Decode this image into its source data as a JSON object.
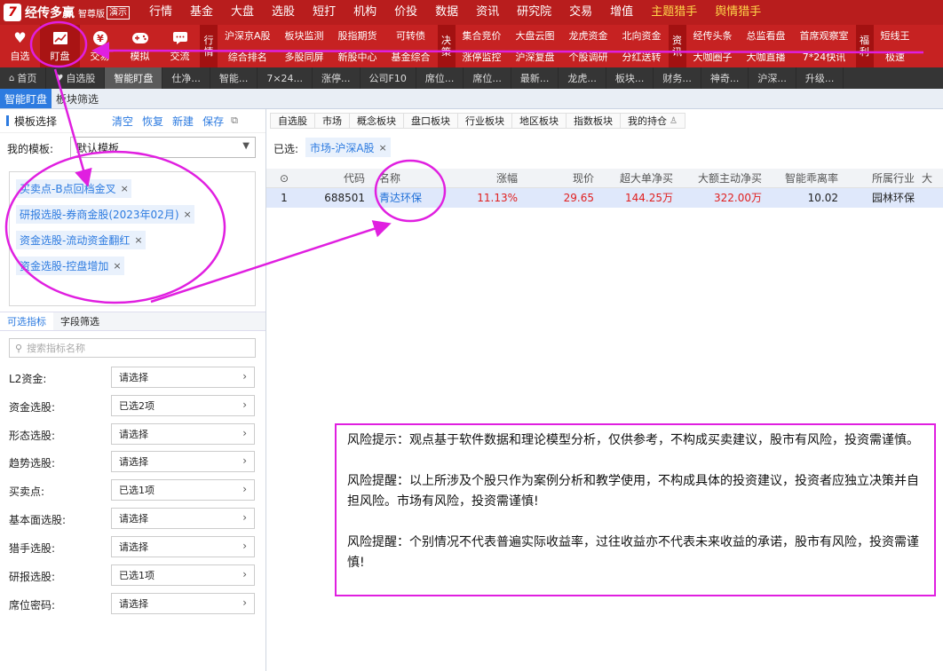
{
  "menubar": {
    "logo_mark": "7",
    "app_name": "经传多赢",
    "edition": "智尊版",
    "demo_badge": "演示",
    "items": [
      "行情",
      "基金",
      "大盘",
      "选股",
      "短打",
      "机构",
      "价投",
      "数据",
      "资讯",
      "研究院",
      "交易",
      "增值",
      "主题猎手",
      "舆情猎手"
    ]
  },
  "toolbar": {
    "buttons": [
      {
        "label": "自选",
        "icon": "heart-icon"
      },
      {
        "label": "盯盘",
        "icon": "chart-monitor-icon"
      },
      {
        "label": "交易",
        "icon": "yen-icon"
      },
      {
        "label": "模拟",
        "icon": "gamepad-icon"
      },
      {
        "label": "交流",
        "icon": "chat-icon"
      }
    ],
    "groups": [
      {
        "vlabel": [
          "行",
          "情"
        ],
        "links": [
          "沪深京A股",
          "综合排名",
          "板块监测",
          "多股同屏",
          "股指期货",
          "新股中心",
          "可转债",
          "基金综合"
        ]
      },
      {
        "vlabel": [
          "决",
          "策"
        ],
        "links": [
          "集合竞价",
          "涨停监控",
          "大盘云图",
          "沪深复盘",
          "龙虎资金",
          "个股调研",
          "北向资金",
          "分红送转"
        ]
      },
      {
        "vlabel": [
          "资",
          "讯"
        ],
        "links": [
          "经传头条",
          "大咖圈子",
          "总监看盘",
          "大咖直播",
          "首席观察室",
          "7*24快讯"
        ]
      },
      {
        "vlabel": [
          "福",
          "利"
        ],
        "links": [
          "短线王",
          "极速"
        ]
      }
    ]
  },
  "tabbar": {
    "items": [
      {
        "label": "首页",
        "icon": "home-icon"
      },
      {
        "label": "自选股",
        "icon": "heart-icon"
      },
      {
        "label": "智能盯盘",
        "icon": ""
      },
      {
        "label": "仕净...",
        "icon": ""
      },
      {
        "label": "智能...",
        "icon": ""
      },
      {
        "label": "7×24...",
        "icon": ""
      },
      {
        "label": "涨停...",
        "icon": ""
      },
      {
        "label": "公司F10",
        "icon": ""
      },
      {
        "label": "席位...",
        "icon": ""
      },
      {
        "label": "席位...",
        "icon": ""
      },
      {
        "label": "最新...",
        "icon": ""
      },
      {
        "label": "龙虎...",
        "icon": ""
      },
      {
        "label": "板块...",
        "icon": ""
      },
      {
        "label": "财务...",
        "icon": ""
      },
      {
        "label": "神奇...",
        "icon": ""
      },
      {
        "label": "沪深...",
        "icon": ""
      },
      {
        "label": "升级...",
        "icon": ""
      }
    ],
    "active_index": 2
  },
  "subtabs": {
    "items": [
      "智能盯盘",
      "板块筛选"
    ],
    "active_index": 0
  },
  "left": {
    "title": "模板选择",
    "actions": {
      "clear": "清空",
      "restore": "恢复",
      "new": "新建",
      "save": "保存"
    },
    "my_template_label": "我的模板:",
    "my_template_value": "默认模板",
    "tags": [
      "买卖点-B点回档金叉",
      "研报选股-券商金股(2023年02月)",
      "资金选股-流动资金翻红",
      "资金选股-控盘增加"
    ],
    "field_tabs": [
      "可选指标",
      "字段筛选"
    ],
    "field_tab_active": 0,
    "search_placeholder": "搜索指标名称",
    "criteria": [
      {
        "label": "L2资金:",
        "value": "请选择"
      },
      {
        "label": "资金选股:",
        "value": "已选2项"
      },
      {
        "label": "形态选股:",
        "value": "请选择"
      },
      {
        "label": "趋势选股:",
        "value": "请选择"
      },
      {
        "label": "买卖点:",
        "value": "已选1项"
      },
      {
        "label": "基本面选股:",
        "value": "请选择"
      },
      {
        "label": "猎手选股:",
        "value": "请选择"
      },
      {
        "label": "研报选股:",
        "value": "已选1项"
      },
      {
        "label": "席位密码:",
        "value": "请选择"
      }
    ]
  },
  "right": {
    "filter_tabs": [
      "自选股",
      "市场",
      "概念板块",
      "盘口板块",
      "行业板块",
      "地区板块",
      "指数板块",
      "我的持仓"
    ],
    "selected_label": "已选:",
    "selected_chip": "市场-沪深A股",
    "table": {
      "headers": [
        "⊙",
        "代码",
        "名称",
        "涨幅",
        "现价",
        "超大单净买",
        "大额主动净买",
        "智能乖离率",
        "所属行业",
        "大"
      ],
      "rows": [
        [
          "1",
          "688501",
          "青达环保",
          "11.13%",
          "29.65",
          "144.25万",
          "322.00万",
          "10.02",
          "园林环保",
          ""
        ]
      ]
    },
    "risk_notice": [
      "风险提示：观点基于软件数据和理论模型分析，仅供参考，不构成买卖建议，股市有风险，投资需谨慎。",
      "风险提醒：以上所涉及个股只作为案例分析和教学使用，不构成具体的投资建议，投资者应独立决策并自担风险。市场有风险，投资需谨慎!",
      "风险提醒：个别情况不代表普遍实际收益率，过往收益亦不代表未来收益的承诺，股市有风险，投资需谨慎!"
    ]
  },
  "colors": {
    "menu_red": "#b81d1d",
    "toolbar_red": "#c62222",
    "accent_blue": "#2d7be0",
    "up_red": "#e02020",
    "annotation": "#e01fe0"
  }
}
